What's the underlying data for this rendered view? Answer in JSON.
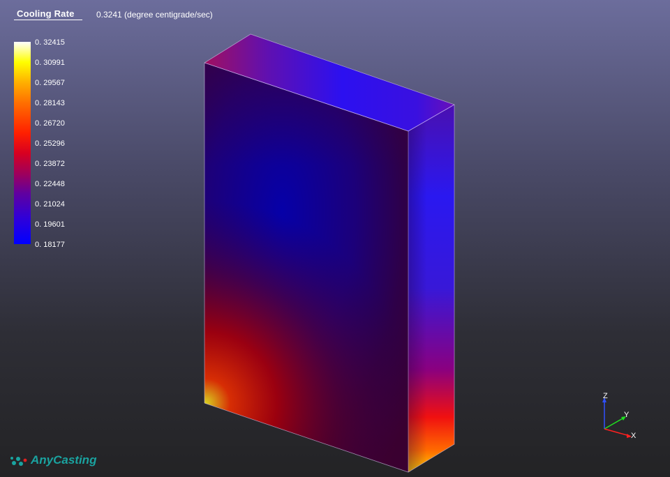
{
  "header": {
    "title": "Cooling Rate",
    "value_readout": "0.3241 (degree centigrade/sec)"
  },
  "legend": {
    "labels": [
      "0. 32415",
      "0. 30991",
      "0. 29567",
      "0. 28143",
      "0. 26720",
      "0. 25296",
      "0. 23872",
      "0. 22448",
      "0. 21024",
      "0. 19601",
      "0. 18177"
    ],
    "colors": {
      "max": "#ffffff",
      "high": "#ffff00",
      "mid_high": "#ff2000",
      "mid": "#a0005a",
      "low": "#0000ff"
    }
  },
  "axes": {
    "z_label": "Z",
    "y_label": "Y",
    "x_label": "X",
    "z_color": "#3050ff",
    "y_color": "#20e020",
    "x_color": "#ff2020"
  },
  "branding": {
    "logo_text": "AnyCasting",
    "logo_color": "#1aa3a0"
  }
}
